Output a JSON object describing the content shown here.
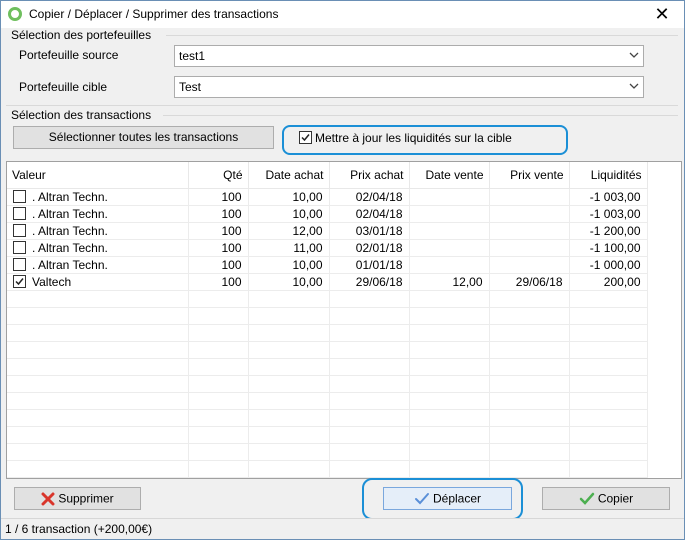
{
  "window": {
    "title": "Copier / Déplacer / Supprimer des transactions",
    "close_glyph": "✕"
  },
  "portfolios": {
    "group_label": "Sélection des portefeuilles",
    "source_label": "Portefeuille source",
    "source_value": "test1",
    "target_label": "Portefeuille cible",
    "target_value": "Test"
  },
  "transactions": {
    "group_label": "Sélection des transactions",
    "select_all_label": "Sélectionner toutes les transactions",
    "update_cash_label": "Mettre à jour les liquidités sur la cible",
    "update_cash_checked": true
  },
  "table": {
    "columns": [
      "Valeur",
      "Qté",
      "Date achat",
      "Prix achat",
      "Date vente",
      "Prix vente",
      "Liquidités"
    ],
    "rows": [
      {
        "checked": false,
        "valeur": ". Altran Techn.",
        "qte": "100",
        "date_achat": "10,00",
        "prix_achat": "02/04/18",
        "date_vente": "",
        "prix_vente": "",
        "liquidites": "-1 003,00"
      },
      {
        "checked": false,
        "valeur": ". Altran Techn.",
        "qte": "100",
        "date_achat": "10,00",
        "prix_achat": "02/04/18",
        "date_vente": "",
        "prix_vente": "",
        "liquidites": "-1 003,00"
      },
      {
        "checked": false,
        "valeur": ". Altran Techn.",
        "qte": "100",
        "date_achat": "12,00",
        "prix_achat": "03/01/18",
        "date_vente": "",
        "prix_vente": "",
        "liquidites": "-1 200,00"
      },
      {
        "checked": false,
        "valeur": ". Altran Techn.",
        "qte": "100",
        "date_achat": "11,00",
        "prix_achat": "02/01/18",
        "date_vente": "",
        "prix_vente": "",
        "liquidites": "-1 100,00"
      },
      {
        "checked": false,
        "valeur": ". Altran Techn.",
        "qte": "100",
        "date_achat": "10,00",
        "prix_achat": "01/01/18",
        "date_vente": "",
        "prix_vente": "",
        "liquidites": "-1 000,00"
      },
      {
        "checked": true,
        "valeur": "Valtech",
        "qte": "100",
        "date_achat": "10,00",
        "prix_achat": "29/06/18",
        "date_vente": "12,00",
        "prix_vente": "29/06/18",
        "liquidites": "200,00"
      }
    ]
  },
  "actions": {
    "delete_label": "Supprimer",
    "move_label": "Déplacer",
    "copy_label": "Copier",
    "delete_icon": "red-x-icon",
    "move_icon": "blue-check-icon",
    "copy_icon": "green-check-icon"
  },
  "status": {
    "text": "1 / 6 transaction (+200,00€)"
  },
  "colors": {
    "highlight": "#1b8fd6",
    "delete": "#d9352b",
    "move": "#5a8fd8",
    "copy": "#4caf50"
  }
}
